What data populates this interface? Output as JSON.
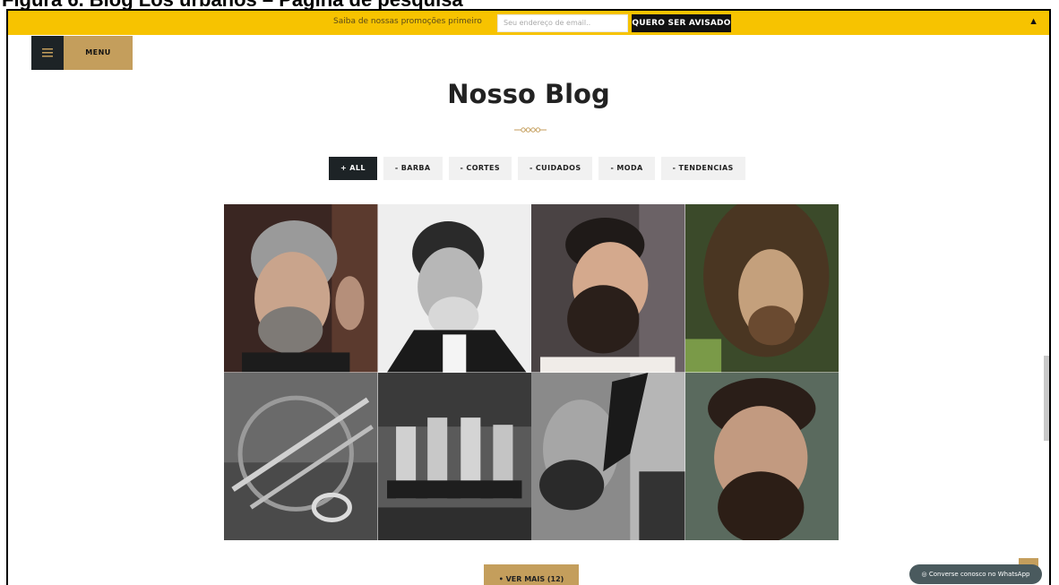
{
  "caption": "Figura 6. Blog Los urbanos – Página de pesquisa",
  "promo": {
    "text": "Saiba de nossas promoções primeiro",
    "email_placeholder": "Seu endereço de email..",
    "button_label": "QUERO SER AVISADO",
    "close_glyph": "▲"
  },
  "menu": {
    "label": "MENU"
  },
  "blog": {
    "title": "Nosso Blog"
  },
  "filters": [
    {
      "label": "+ ALL",
      "active": true
    },
    {
      "label": "- BARBA",
      "active": false
    },
    {
      "label": "- CORTES",
      "active": false
    },
    {
      "label": "- CUIDADOS",
      "active": false
    },
    {
      "label": "- MODA",
      "active": false
    },
    {
      "label": "- TENDENCIAS",
      "active": false
    }
  ],
  "posts": [
    {
      "name": "gray-hair-beard-man-photo"
    },
    {
      "name": "vintage-writer-portrait-photo"
    },
    {
      "name": "dark-beard-profile-photo"
    },
    {
      "name": "long-hair-man-photo"
    },
    {
      "name": "barber-scissors-photo"
    },
    {
      "name": "barbershop-group-photo"
    },
    {
      "name": "beard-trim-photo"
    },
    {
      "name": "bearded-man-closeup-photo"
    }
  ],
  "load_more": {
    "label": "• VER MAIS (12)"
  },
  "whatsapp": {
    "label": "Converse conosco no WhatsApp"
  },
  "colors": {
    "promo_bar": "#f7c300",
    "accent_gold": "#c49e5c",
    "dark": "#1d2326"
  }
}
